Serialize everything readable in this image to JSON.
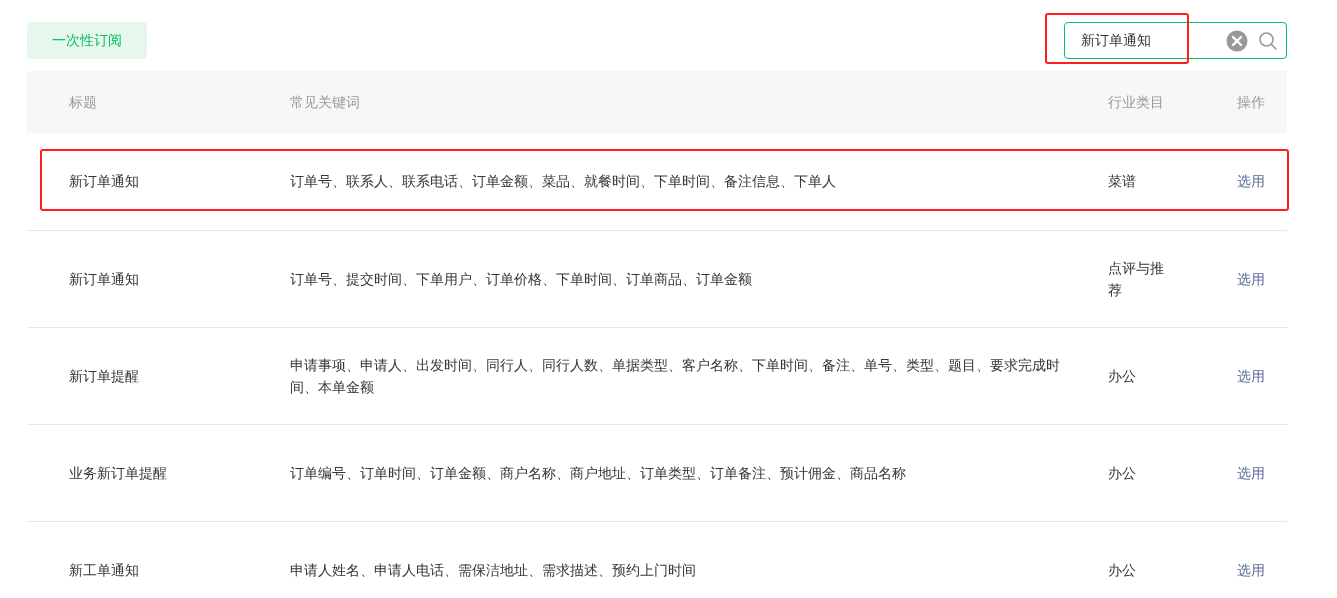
{
  "tab": {
    "label": "一次性订阅",
    "selected": true
  },
  "search": {
    "value": "新订单通知",
    "highlighted": true
  },
  "table": {
    "columns": [
      "标题",
      "常见关键词",
      "行业类目",
      "操作"
    ],
    "rows": [
      {
        "title": "新订单通知",
        "keywords": "订单号、联系人、联系电话、订单金额、菜品、就餐时间、下单时间、备注信息、下单人",
        "category": "菜谱",
        "action": "选用",
        "highlighted": true
      },
      {
        "title": "新订单通知",
        "keywords": "订单号、提交时间、下单用户、订单价格、下单时间、订单商品、订单金额",
        "category": "点评与推荐",
        "action": "选用",
        "highlighted": false
      },
      {
        "title": "新订单提醒",
        "keywords": "申请事项、申请人、出发时间、同行人、同行人数、单据类型、客户名称、下单时间、备注、单号、类型、题目、要求完成时间、本单金额",
        "category": "办公",
        "action": "选用",
        "highlighted": false
      },
      {
        "title": "业务新订单提醒",
        "keywords": "订单编号、订单时间、订单金额、商户名称、商户地址、订单类型、订单备注、预计佣金、商品名称",
        "category": "办公",
        "action": "选用",
        "highlighted": false
      },
      {
        "title": "新工单通知",
        "keywords": "申请人姓名、申请人电话、需保洁地址、需求描述、预约上门时间",
        "category": "办公",
        "action": "选用",
        "highlighted": false
      }
    ]
  }
}
